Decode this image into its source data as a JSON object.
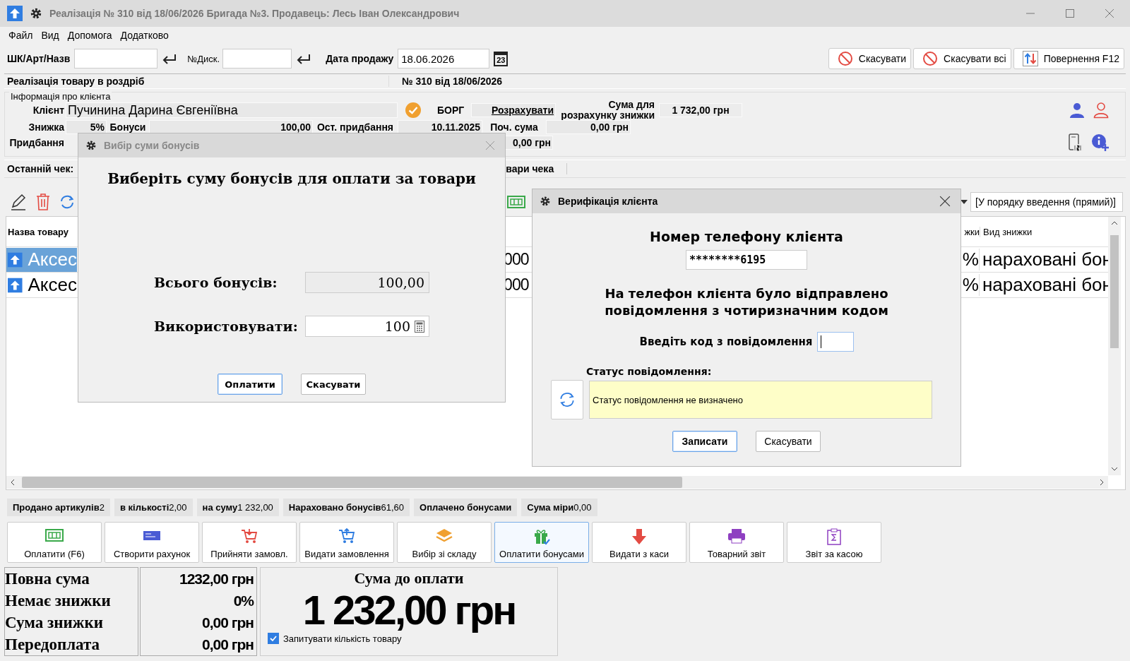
{
  "window": {
    "title": "Реалізація № 310 від 18/06/2026 Бригада №3. Продавець: Лесь Іван Олександрович"
  },
  "menu": [
    "Файл",
    "Вид",
    "Допомога",
    "Додатково"
  ],
  "toolbar": {
    "barcode_label": "ШК/Арт/Назв",
    "card_label": "№Диск.",
    "date_label": "Дата продажу",
    "date_value": "18.06.2026",
    "calendar_day": "23",
    "buttons": [
      {
        "label": "Скасувати",
        "kind": "cancel"
      },
      {
        "label": "Скасувати всі",
        "kind": "cancel"
      },
      {
        "label": "Повернення F12",
        "kind": "return"
      }
    ]
  },
  "header": {
    "title": "Реалізація товару в роздріб",
    "number": "№ 310 від 18/06/2026"
  },
  "client": {
    "group_label": "Інформація про клієнта",
    "client_label": "Клієнт",
    "client_name": "Пучинина Дарина Євгеніївна",
    "verified": true,
    "debt_label": "БОРГ",
    "debt_link": "Розрахувати",
    "discount_base_label": "Сума для розрахунку знижки",
    "discount_base_value": "1 732,00 грн",
    "discount_label": "Знижка",
    "discount_value": "5%",
    "bonus_label": "Бонуси",
    "bonus_value": "100,00",
    "last_purchase_label": "Ост. придбання",
    "last_purchase_value": "10.11.2025",
    "start_sum_label": "Поч. сума",
    "start_sum_value": "0,00 грн",
    "purchase_label": "Придбання",
    "purchase_value": "0,00 грн"
  },
  "last_check": {
    "label": "Останній чек:",
    "items_tab": "вари чека"
  },
  "table": {
    "sort": "[У порядку введення (прямий)]",
    "columns": [
      "Назва товару",
      "жки",
      "Вид знижки"
    ],
    "rows": [
      {
        "name": "Аксес",
        "amount": "000",
        "discount": "%",
        "discount_kind": "нараховані бон",
        "selected": true
      },
      {
        "name": "Аксес",
        "amount": "000",
        "discount": "%",
        "discount_kind": "нараховані бон",
        "selected": false
      }
    ]
  },
  "summary": [
    {
      "label": "Продано артикулів",
      "value": "2"
    },
    {
      "label": "в кількості",
      "value": "2,00"
    },
    {
      "label": "на суму",
      "value": "1 232,00"
    },
    {
      "label": "Нараховано бонусів",
      "value": "61,60"
    },
    {
      "label": "Оплачено бонусами"
    },
    {
      "label": "Сума міри",
      "value": "0,00"
    }
  ],
  "actions": [
    {
      "label": "Оплатити (F6)",
      "kind": "cash",
      "selected": false
    },
    {
      "label": "Створити рахунок",
      "kind": "invoice",
      "selected": false
    },
    {
      "label": "Прийняти замовл.",
      "kind": "cart-in",
      "selected": false
    },
    {
      "label": "Видати замовлення",
      "kind": "cart-out",
      "selected": false
    },
    {
      "label": "Вибір зі складу",
      "kind": "layers",
      "selected": false
    },
    {
      "label": "Оплатити бонусами",
      "kind": "gift",
      "selected": true
    },
    {
      "label": "Видати з каси",
      "kind": "down",
      "selected": false
    },
    {
      "label": "Товарний звіт",
      "kind": "print",
      "selected": false
    },
    {
      "label": "Звіт за касою",
      "kind": "report",
      "selected": false
    }
  ],
  "totals": {
    "rows": [
      {
        "label": "Повна сума",
        "value": "1232,00 грн"
      },
      {
        "label": "Немає знижки",
        "value": "0%"
      },
      {
        "label": "Сума знижки",
        "value": "0,00 грн"
      },
      {
        "label": "Передоплата",
        "value": "0,00 грн"
      }
    ],
    "due_label": "Сума до оплати",
    "due_value": "1 232,00 грн",
    "ask_quantity": {
      "label": "Запитувати кількість товару",
      "checked": true
    }
  },
  "bonus_dialog": {
    "title": "Вибір суми бонусів",
    "heading": "Виберіть суму бонусів для оплати за товари",
    "total_label": "Всього бонусів:",
    "total_value": "100,00",
    "use_label": "Використовувати:",
    "use_value": "100",
    "buttons": [
      {
        "label": "Оплатити",
        "selected": true
      },
      {
        "label": "Скасувати",
        "selected": false
      }
    ]
  },
  "verify_dialog": {
    "title": "Верифікація клієнта",
    "phone_label": "Номер телефону клієнта",
    "phone_value": "********6195",
    "message": "На телефон клієнта було відправлено повідомлення з чотиризначним кодом",
    "code_label": "Введіть код з повідомлення",
    "status_label": "Статус повідомлення:",
    "status_text": "Статус повідомлення не визначено",
    "buttons": [
      {
        "label": "Записати",
        "selected": true
      },
      {
        "label": "Скасувати",
        "selected": false
      }
    ]
  }
}
